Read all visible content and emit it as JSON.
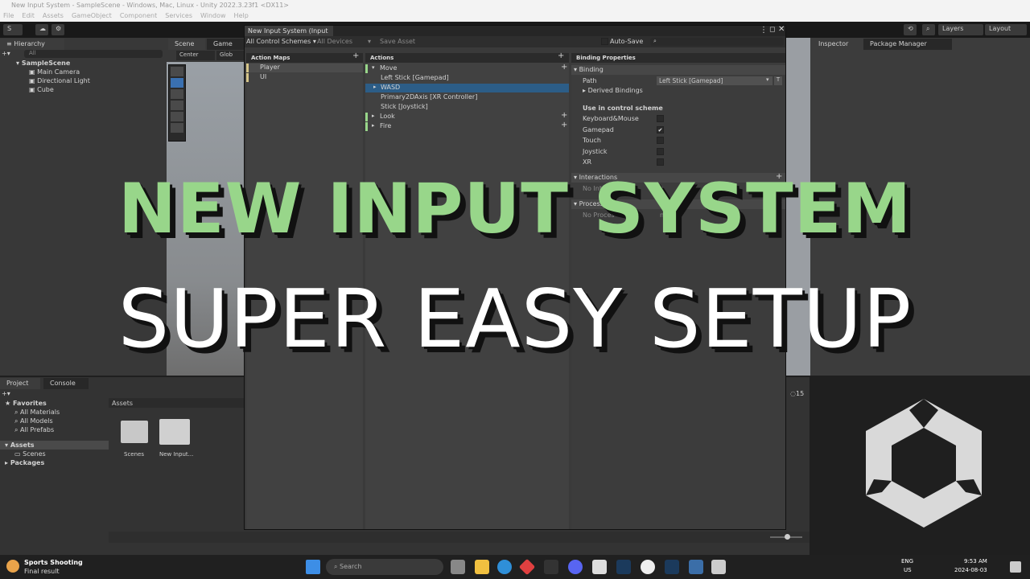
{
  "window": {
    "title": "New Input System - SampleScene - Windows, Mac, Linux - Unity 2022.3.23f1 <DX11>"
  },
  "menu": [
    "File",
    "Edit",
    "Assets",
    "GameObject",
    "Component",
    "Services",
    "Window",
    "Help"
  ],
  "toolbar": {
    "account": "S",
    "layers": "Layers",
    "layout": "Layout"
  },
  "hierarchy": {
    "tab": "Hierarchy",
    "search_placeholder": "All",
    "scene": "SampleScene",
    "items": [
      "Main Camera",
      "Directional Light",
      "Cube"
    ]
  },
  "scene_tabs": {
    "scene": "Scene",
    "game": "Game",
    "pivot": "Center",
    "space": "Glob"
  },
  "input_actions": {
    "title": "New Input System (Input ...",
    "control_schemes": "All Control Schemes",
    "devices": "All Devices",
    "save_asset": "Save Asset",
    "auto_save": "Auto-Save",
    "action_maps_header": "Action Maps",
    "action_maps": [
      "Player",
      "UI"
    ],
    "actions_header": "Actions",
    "actions": [
      {
        "label": "Move",
        "indent": 0
      },
      {
        "label": "Left Stick [Gamepad]",
        "indent": 1
      },
      {
        "label": "WASD",
        "indent": 1,
        "selected": true
      },
      {
        "label": "Primary2DAxis [XR Controller]",
        "indent": 1
      },
      {
        "label": "Stick [Joystick]",
        "indent": 1
      },
      {
        "label": "Look",
        "indent": 0
      },
      {
        "label": "Fire",
        "indent": 0
      }
    ],
    "binding_props_header": "Binding Properties",
    "binding": "Binding",
    "path_label": "Path",
    "path_value": "Left Stick [Gamepad]",
    "path_t": "T",
    "derived": "Derived Bindings",
    "use_in_scheme": "Use in control scheme",
    "schemes": [
      {
        "label": "Keyboard&Mouse",
        "checked": false
      },
      {
        "label": "Gamepad",
        "checked": true
      },
      {
        "label": "Touch",
        "checked": false
      },
      {
        "label": "Joystick",
        "checked": false
      },
      {
        "label": "XR",
        "checked": false
      }
    ],
    "interactions": "Interactions",
    "no_interactions": "No Interac",
    "no_interactions_end": "n",
    "processors": "Processo",
    "no_processors": "No Proces",
    "no_processors_end": "n adde"
  },
  "inspector": {
    "tab": "Inspector",
    "package_manager": "Package Manager"
  },
  "project": {
    "tab": "Project",
    "console": "Console",
    "favorites": "Favorites",
    "fav_items": [
      "All Materials",
      "All Models",
      "All Prefabs"
    ],
    "assets": "Assets",
    "asset_items": [
      "Scenes"
    ],
    "packages": "Packages",
    "assets_header": "Assets",
    "files": [
      "Scenes",
      "New Input..."
    ],
    "count": "15"
  },
  "headline": {
    "line1": "NEW INPUT SYSTEM",
    "line2": "SUPER EASY SETUP"
  },
  "taskbar": {
    "notification_title": "Sports Shooting",
    "notification_sub": "Final result",
    "search": "Search",
    "lang": "ENG",
    "region": "US",
    "time": "9:53 AM",
    "date": "2024-08-03"
  },
  "colors": {
    "headline_green": "#98d68a",
    "selection": "#2c5d87",
    "unity_bg": "#383838"
  }
}
